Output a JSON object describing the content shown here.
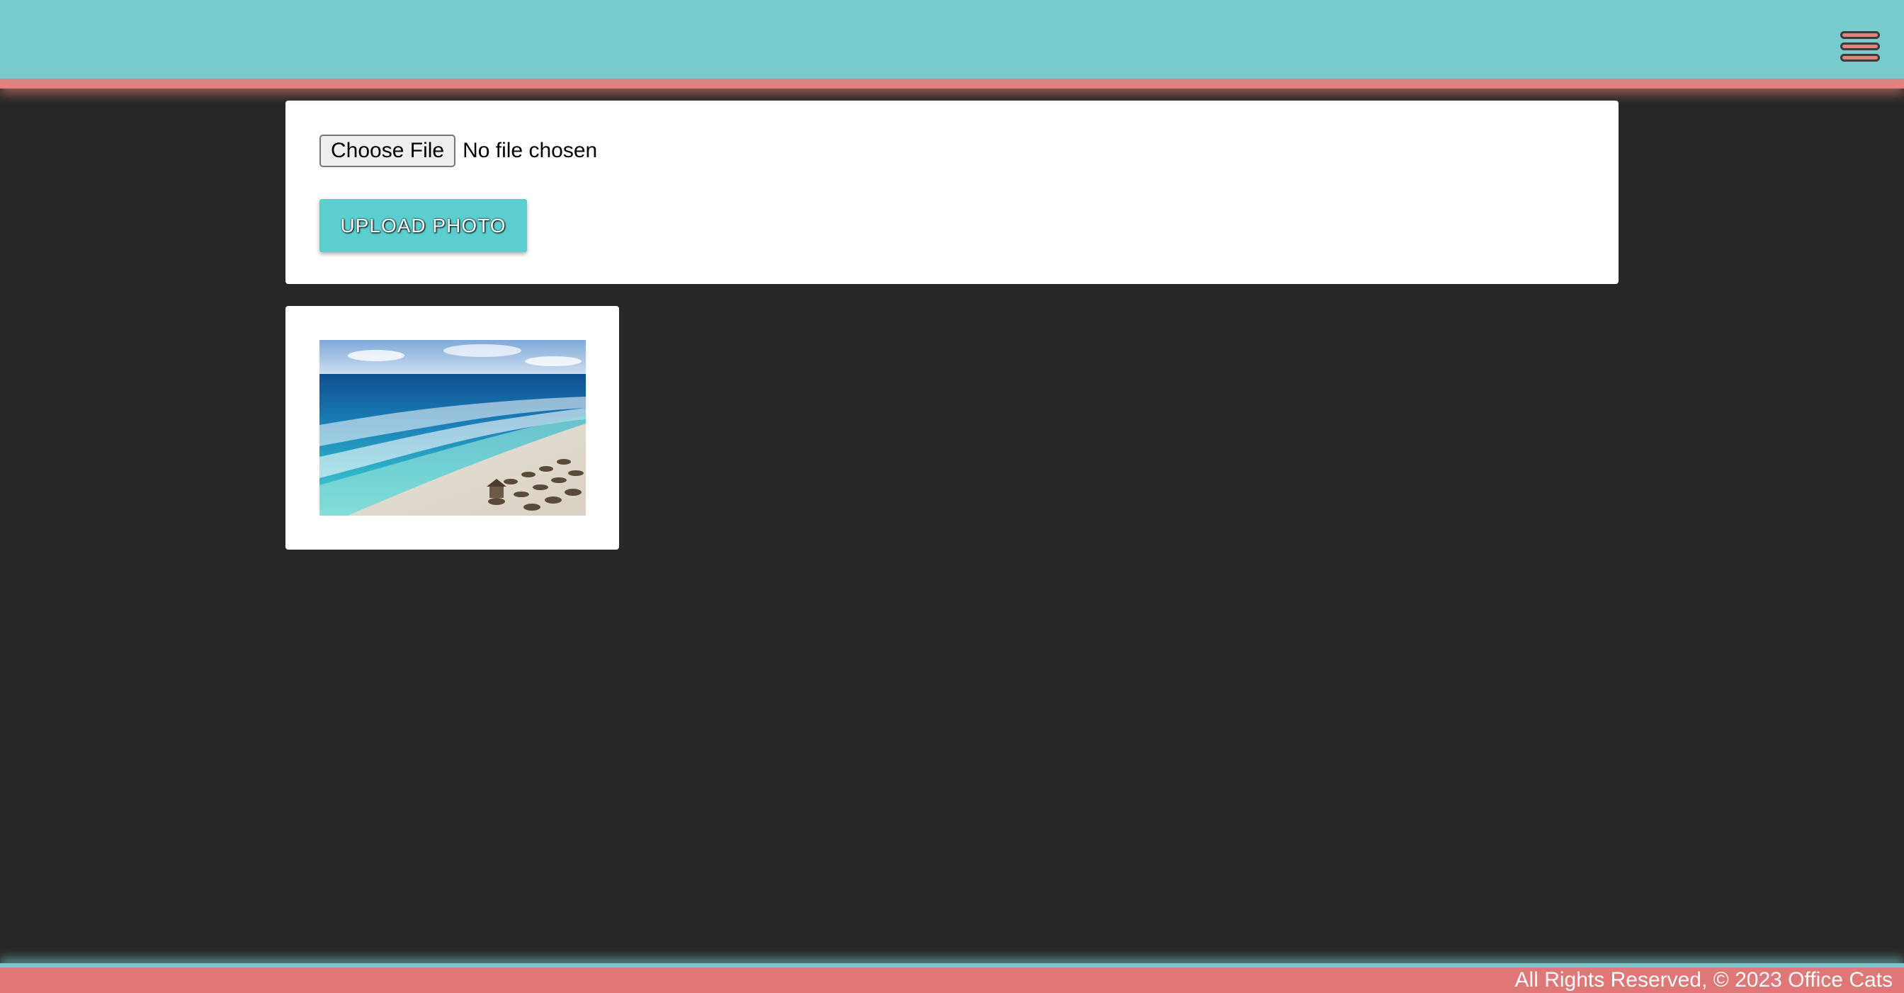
{
  "header": {
    "menu_icon": "hamburger-menu-icon"
  },
  "upload": {
    "choose_file_label": "Choose File",
    "file_status": "No file chosen",
    "upload_button_label": "UPLOAD PHOTO"
  },
  "gallery": {
    "photos": [
      {
        "description_icon": "beach-photo"
      }
    ]
  },
  "footer": {
    "text": "All Rights Reserved, © 2023 Office Cats"
  },
  "colors": {
    "header_bg": "#77cbcd",
    "accent_pink": "#e2817e",
    "page_bg": "#282726",
    "button_teal": "#5bcfd0",
    "footer_bg": "#e07776"
  }
}
